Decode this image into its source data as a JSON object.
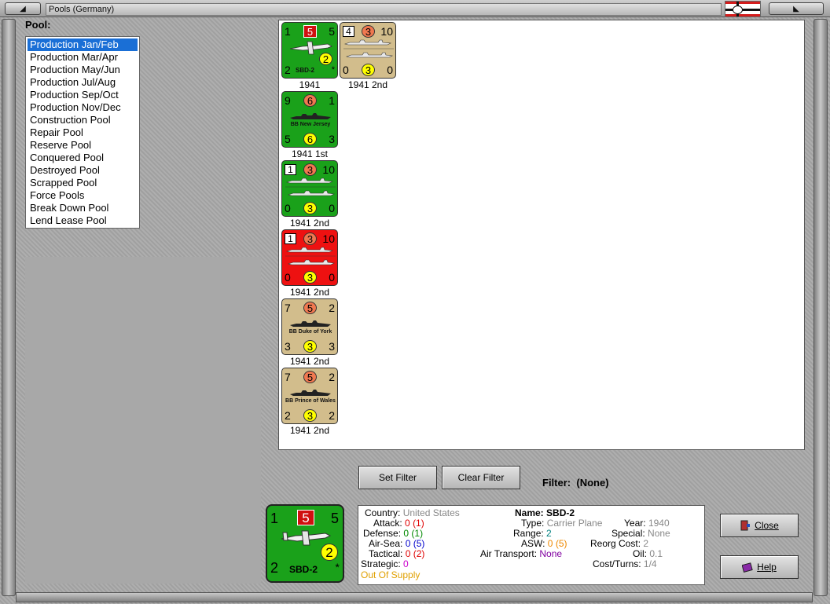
{
  "window": {
    "title": "Pools (Germany)",
    "left_button": "◢",
    "right_button": "◣"
  },
  "pool": {
    "label": "Pool:",
    "items": [
      {
        "label": "Production Jan/Feb",
        "selected": true
      },
      {
        "label": "Production Mar/Apr"
      },
      {
        "label": "Production May/Jun"
      },
      {
        "label": "Production Jul/Aug"
      },
      {
        "label": "Production Sep/Oct"
      },
      {
        "label": "Production Nov/Dec"
      },
      {
        "label": "Construction Pool"
      },
      {
        "label": "Repair Pool"
      },
      {
        "label": "Reserve Pool"
      },
      {
        "label": "Conquered Pool"
      },
      {
        "label": "Destroyed Pool"
      },
      {
        "label": "Scrapped Pool"
      },
      {
        "label": "Force Pools"
      },
      {
        "label": "Break Down Pool"
      },
      {
        "label": "Lend Lease Pool"
      }
    ]
  },
  "units": [
    {
      "tl": "1",
      "tc": "5",
      "tr": "5",
      "bl": "2",
      "bc": "2",
      "br": "*",
      "name": "SBD-2",
      "caption": "1941",
      "color": "#1aa11a",
      "kind": "plane"
    },
    {
      "box": "4",
      "tc": "3",
      "tr": "10",
      "bl": "0",
      "bc": "3",
      "br": "0",
      "name": "",
      "caption": "1941 2nd",
      "color": "#d2bd8c",
      "kind": "convoy"
    },
    {
      "tl": "9",
      "tc": "6",
      "tr": "1",
      "bl": "5",
      "bc": "6",
      "br": "3",
      "name": "BB New Jersey",
      "caption": "1941 1st",
      "color": "#1aa11a",
      "kind": "ship"
    },
    {
      "box": "1",
      "tc": "3",
      "tr": "10",
      "bl": "0",
      "bc": "3",
      "br": "0",
      "name": "",
      "caption": "1941 2nd",
      "color": "#1aa11a",
      "kind": "convoy"
    },
    {
      "box": "1",
      "tc": "3",
      "tr": "10",
      "bl": "0",
      "bc": "3",
      "br": "0",
      "name": "",
      "caption": "1941 2nd",
      "color": "#ee1111",
      "kind": "convoy"
    },
    {
      "tl": "7",
      "tc": "5",
      "tr": "2",
      "bl": "3",
      "bc": "3",
      "br": "3",
      "name": "BB Duke of York",
      "caption": "1941 2nd",
      "color": "#d2bd8c",
      "kind": "ship"
    },
    {
      "tl": "7",
      "tc": "5",
      "tr": "2",
      "bl": "2",
      "bc": "3",
      "br": "2",
      "name": "BB Prince of Wales",
      "caption": "1941 2nd",
      "color": "#d2bd8c",
      "kind": "ship"
    }
  ],
  "filter": {
    "set_label": "Set Filter",
    "clear_label": "Clear Filter",
    "status_label": "Filter:",
    "status_value": "(None)"
  },
  "selected_unit": {
    "tl": "1",
    "tc": "5",
    "tr": "5",
    "bl": "2",
    "bc": "2",
    "br": "*",
    "name": "SBD-2"
  },
  "info": {
    "country_label": "Country:",
    "country": "United States",
    "attack_label": "Attack:",
    "attack": "0",
    "attack_alt": "(1)",
    "defense_label": "Defense:",
    "defense": "0",
    "defense_alt": "(1)",
    "airsea_label": "Air-Sea:",
    "airsea": "0",
    "airsea_alt": "(5)",
    "tactical_label": "Tactical:",
    "tactical": "0",
    "tactical_alt": "(2)",
    "strategic_label": "Strategic:",
    "strategic": "0",
    "supply": "Out Of Supply",
    "name_label": "Name:",
    "name": "SBD-2",
    "type_label": "Type:",
    "type": "Carrier Plane",
    "range_label": "Range:",
    "range": "2",
    "asw_label": "ASW:",
    "asw": "0",
    "asw_alt": "(5)",
    "air_transport_label": "Air Transport:",
    "air_transport": "None",
    "year_label": "Year:",
    "year": "1940",
    "special_label": "Special:",
    "special": "None",
    "reorg_label": "Reorg Cost:",
    "reorg": "2",
    "oil_label": "Oil:",
    "oil": "0.1",
    "cost_label": "Cost/Turns:",
    "cost": "1/4"
  },
  "buttons": {
    "close_label": "Close",
    "help_label": "Help"
  }
}
